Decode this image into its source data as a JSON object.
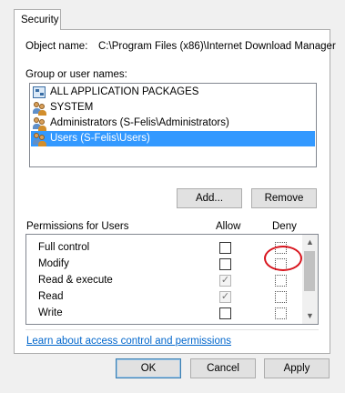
{
  "tab": {
    "label": "Security"
  },
  "object": {
    "label": "Object name:",
    "value": "C:\\Program Files (x86)\\Internet Download Manager"
  },
  "groups": {
    "label": "Group or user names:",
    "items": [
      {
        "label": "ALL APPLICATION PACKAGES",
        "icon": "package-icon"
      },
      {
        "label": "SYSTEM",
        "icon": "users-icon"
      },
      {
        "label": "Administrators (S-Felis\\Administrators)",
        "icon": "users-icon"
      },
      {
        "label": "Users (S-Felis\\Users)",
        "icon": "users-icon",
        "selected": true
      }
    ]
  },
  "buttons": {
    "add": "Add...",
    "remove": "Remove",
    "ok": "OK",
    "cancel": "Cancel",
    "apply": "Apply"
  },
  "permissions": {
    "label": "Permissions for Users",
    "allow_header": "Allow",
    "deny_header": "Deny",
    "rows": [
      {
        "name": "Full control",
        "allow": false,
        "deny": false
      },
      {
        "name": "Modify",
        "allow": false,
        "deny": false
      },
      {
        "name": "Read & execute",
        "allow": true,
        "deny": false
      },
      {
        "name": "Read",
        "allow": true,
        "deny": false
      },
      {
        "name": "Write",
        "allow": false,
        "deny": false
      }
    ]
  },
  "link": {
    "text": "Learn about access control and permissions"
  },
  "colors": {
    "selection": "#3399ff",
    "link": "#0066cc",
    "highlight_circle": "#d8141d"
  }
}
